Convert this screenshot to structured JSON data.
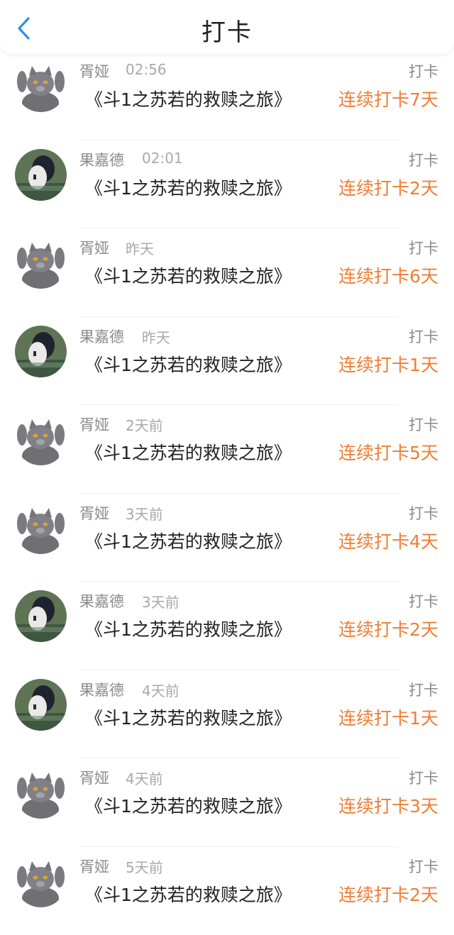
{
  "header": {
    "title": "打卡"
  },
  "colors": {
    "accent_blue": "#2f8fe8",
    "streak_orange": "#f07d34",
    "meta_gray": "#8a8a8a"
  },
  "items": [
    {
      "user": "胥娅",
      "time": "02:56",
      "title": "《斗1之苏若的救赎之旅》",
      "action": "打卡",
      "streak": "连续打卡7天",
      "avatar": "cat-avatar"
    },
    {
      "user": "果嘉德",
      "time": "02:01",
      "title": "《斗1之苏若的救赎之旅》",
      "action": "打卡",
      "streak": "连续打卡2天",
      "avatar": "anime-avatar"
    },
    {
      "user": "胥娅",
      "time": "昨天",
      "title": "《斗1之苏若的救赎之旅》",
      "action": "打卡",
      "streak": "连续打卡6天",
      "avatar": "cat-avatar"
    },
    {
      "user": "果嘉德",
      "time": "昨天",
      "title": "《斗1之苏若的救赎之旅》",
      "action": "打卡",
      "streak": "连续打卡1天",
      "avatar": "anime-avatar"
    },
    {
      "user": "胥娅",
      "time": "2天前",
      "title": "《斗1之苏若的救赎之旅》",
      "action": "打卡",
      "streak": "连续打卡5天",
      "avatar": "cat-avatar"
    },
    {
      "user": "胥娅",
      "time": "3天前",
      "title": "《斗1之苏若的救赎之旅》",
      "action": "打卡",
      "streak": "连续打卡4天",
      "avatar": "cat-avatar"
    },
    {
      "user": "果嘉德",
      "time": "3天前",
      "title": "《斗1之苏若的救赎之旅》",
      "action": "打卡",
      "streak": "连续打卡2天",
      "avatar": "anime-avatar"
    },
    {
      "user": "果嘉德",
      "time": "4天前",
      "title": "《斗1之苏若的救赎之旅》",
      "action": "打卡",
      "streak": "连续打卡1天",
      "avatar": "anime-avatar"
    },
    {
      "user": "胥娅",
      "time": "4天前",
      "title": "《斗1之苏若的救赎之旅》",
      "action": "打卡",
      "streak": "连续打卡3天",
      "avatar": "cat-avatar"
    },
    {
      "user": "胥娅",
      "time": "5天前",
      "title": "《斗1之苏若的救赎之旅》",
      "action": "打卡",
      "streak": "连续打卡2天",
      "avatar": "cat-avatar"
    }
  ]
}
